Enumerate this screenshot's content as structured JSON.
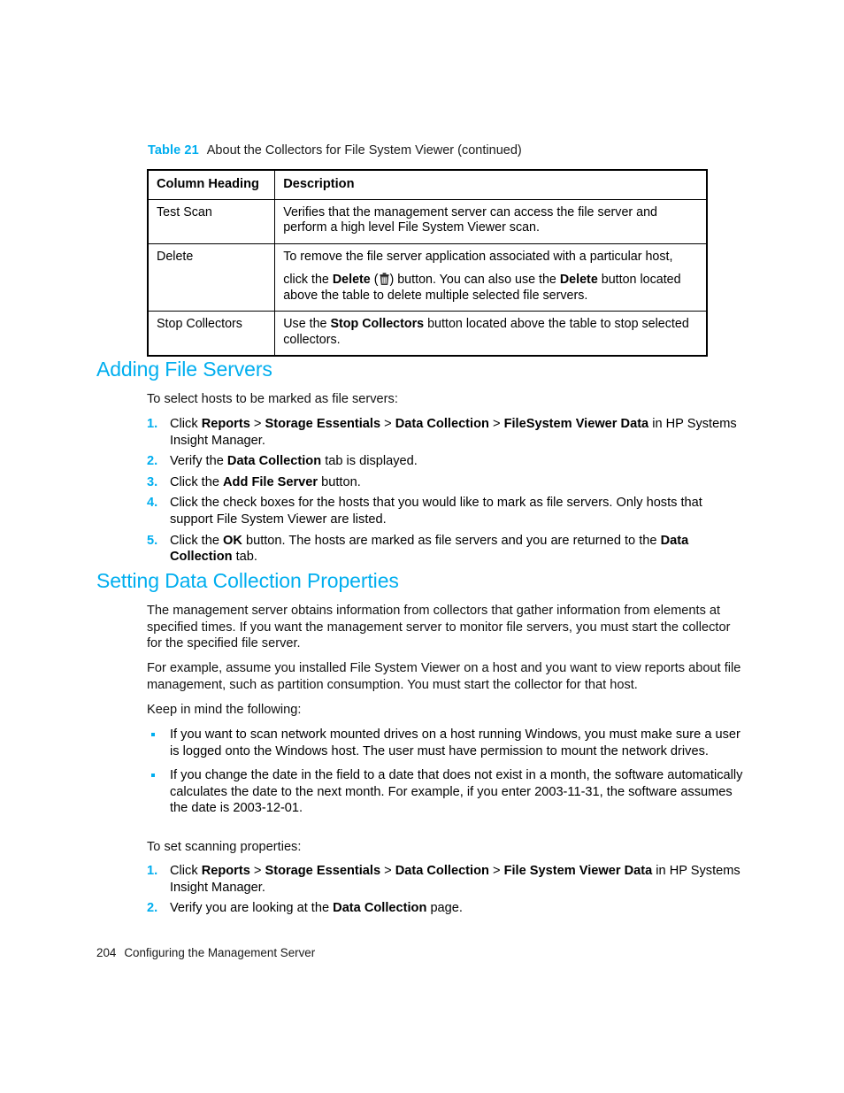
{
  "document": {
    "table_caption": {
      "number": "Table 21",
      "title": "About the Collectors for File System Viewer (continued)"
    },
    "table": {
      "headers": [
        "Column Heading",
        "Description"
      ],
      "rows": [
        {
          "column_heading": "Test Scan",
          "description_line1": "Verifies that the management server can access the file server and",
          "description_line2": "perform a high level File System Viewer scan."
        },
        {
          "column_heading": "Delete",
          "para1": "To remove the file server application associated with a particular host,",
          "para2_pre": "click the ",
          "para2_bold1": "Delete",
          "para2_paren_open": " (",
          "para2_icon": "trash-icon",
          "para2_paren_close": ") button. You can also use the ",
          "para2_bold2": "Delete",
          "para2_post": " button located above the table to delete multiple selected file servers."
        },
        {
          "column_heading": "Stop Collectors",
          "para1_pre": "Use the ",
          "para1_bold": "Stop Collectors",
          "para1_post": " button located above the table to stop selected collectors."
        }
      ]
    },
    "section_adding": {
      "heading": "Adding File Servers",
      "intro": "To select hosts to be marked as file servers:",
      "steps": [
        {
          "num": "1.",
          "pre": "Click ",
          "b1": "Reports",
          "s1": " > ",
          "b2": "Storage Essentials",
          "s2": " > ",
          "b3": "Data Collection",
          "s3": " > ",
          "b4": "FileSystem Viewer Data",
          "post": " in HP Systems Insight Manager."
        },
        {
          "num": "2.",
          "pre": "Verify the ",
          "b1": "Data Collection",
          "post": " tab is displayed."
        },
        {
          "num": "3.",
          "pre": "Click the ",
          "b1": "Add File Server",
          "post": " button."
        },
        {
          "num": "4.",
          "pre": "Click the check boxes for the hosts that you would like to mark as file servers. Only hosts that support File System Viewer are listed.",
          "b1": "",
          "post": ""
        },
        {
          "num": "5.",
          "pre": "Click the ",
          "b1": "OK",
          "mid": " button. The hosts are marked as file servers and you are returned to the ",
          "b2": "Data Collection",
          "post": " tab."
        }
      ]
    },
    "section_setting": {
      "heading": "Setting Data Collection Properties",
      "para1": "The management server obtains information from collectors that gather information from elements at specified times. If you want the management server to monitor file servers, you must start the collector for the specified file server.",
      "para2": "For example, assume you installed File System Viewer on a host and you want to view reports about file management, such as partition consumption. You must start the collector for that host.",
      "para3": "Keep in mind the following:",
      "bullets": [
        "If you want to scan network mounted drives on a host running Windows, you must make sure a user is logged onto the Windows host. The user must have permission to mount the network drives.",
        "If you change the date in the field to a date that does not exist in a month, the software automatically calculates the date to the next month. For example, if you enter 2003-11-31, the software assumes the date is 2003-12-01."
      ],
      "intro2": "To set scanning properties:",
      "steps": [
        {
          "num": "1.",
          "pre": "Click ",
          "b1": "Reports",
          "s1": " > ",
          "b2": "Storage Essentials",
          "s2": " > ",
          "b3": "Data Collection",
          "s3": " > ",
          "b4": "File System Viewer Data",
          "post": " in HP Systems Insight Manager."
        },
        {
          "num": "2.",
          "pre": "Verify you are looking at the ",
          "b1": "Data Collection",
          "post": " page."
        }
      ]
    },
    "footer": {
      "page_number": "204",
      "chapter": "Configuring the Management Server"
    },
    "colors": {
      "accent": "#00AEEF",
      "text": "#111111",
      "rule": "#000000"
    }
  }
}
